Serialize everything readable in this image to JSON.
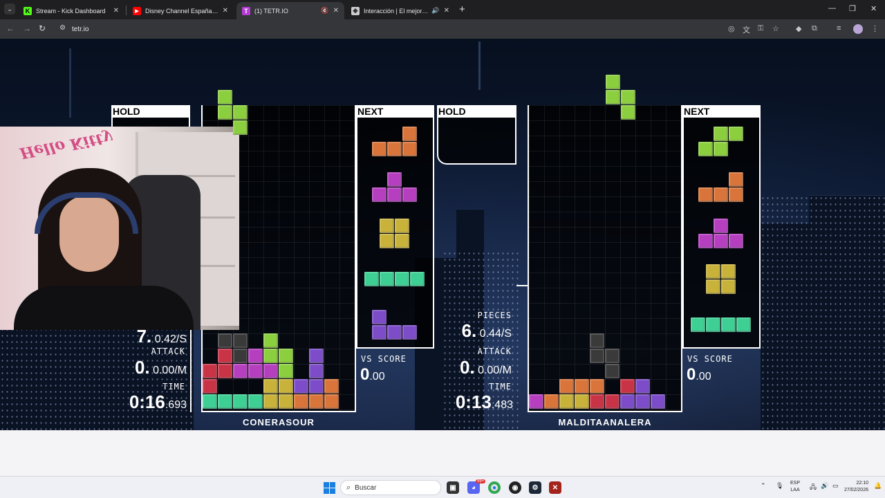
{
  "browser": {
    "tabs": [
      {
        "label": "Stream - Kick Dashboard",
        "icon": "kick-icon",
        "color": "#53fc18"
      },
      {
        "label": "Disney Channel España | Videos",
        "icon": "youtube-icon",
        "color": "#ff0000"
      },
      {
        "label": "(1) TETR.IO",
        "icon": "tetrio-icon",
        "color": "#b83bd8"
      },
      {
        "label": "Interacción | El mejor software",
        "icon": "website-icon",
        "color": "#cccccc"
      }
    ],
    "new_tab": "+",
    "url": "tetr.io"
  },
  "game": {
    "hold_label": "HOLD",
    "next_label": "NEXT",
    "player1": {
      "name": "CONERASOUR",
      "pps_big": "7.",
      "pps_small": "0.42/S",
      "attack_label": "ATTACK",
      "attack_big": "0.",
      "attack_small": "0.00/M",
      "time_label": "TIME",
      "time_big": "0:16",
      "time_small": ".693",
      "vs_label": "VS SCORE",
      "vs_big": "0",
      "vs_small": ".00"
    },
    "player2": {
      "name": "MALDITAANALERA",
      "pieces_label": "PIECES",
      "pps_big": "6.",
      "pps_small": "0.44/S",
      "attack_label": "ATTACK",
      "attack_big": "0.",
      "attack_small": "0.00/M",
      "time_label": "TIME",
      "time_big": "0:13",
      "time_small": ".483",
      "vs_label": "VS SCORE",
      "vs_big": "0",
      "vs_small": ".00"
    },
    "colors": {
      "Z": "#c93346",
      "L": "#d9753a",
      "O": "#c8b23a",
      "S": "#8ccf3e",
      "I": "#3ecf94",
      "J": "#7c4cc9",
      "T": "#b63fc0",
      "G": "#3a3a3a"
    }
  },
  "webcam": {
    "poster_text": "Hello Kitty"
  },
  "taskbar": {
    "search_placeholder": "Buscar",
    "lang_top": "ESP",
    "lang_bottom": "LAA",
    "time": "22:10",
    "date": "27/02/2026",
    "badge": "99+"
  }
}
